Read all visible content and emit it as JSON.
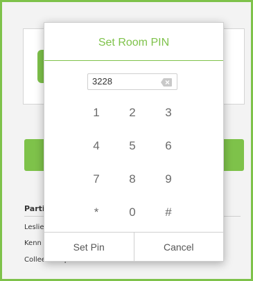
{
  "background": {
    "participants_title": "Parti",
    "participants": [
      "Leslie",
      "Kenn",
      "Colleen Carporal"
    ]
  },
  "dialog": {
    "title": "Set Room PIN",
    "pin_value": "3228",
    "keys": [
      "1",
      "2",
      "3",
      "4",
      "5",
      "6",
      "7",
      "8",
      "9",
      "*",
      "0",
      "#"
    ],
    "set_button": "Set Pin",
    "cancel_button": "Cancel"
  },
  "colors": {
    "accent": "#7ec24a",
    "key_text": "#6a6a6a"
  },
  "icons": {
    "backspace": "backspace-icon"
  }
}
